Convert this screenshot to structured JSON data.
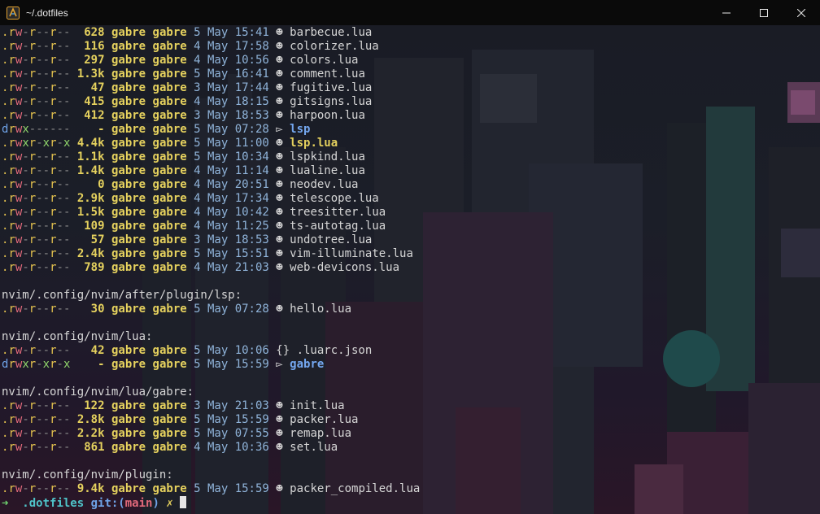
{
  "window": {
    "title": "~/.dotfiles",
    "minimize_icon": "minimize-icon",
    "maximize_icon": "maximize-icon",
    "close_icon": "close-icon"
  },
  "listing_1": [
    {
      "perms": ".rw-r--r--",
      "size": "628",
      "owner": "gabre gabre",
      "date": "5 May 15:41",
      "icon": "lua-file-icon",
      "glyph": "☻",
      "name": "barbecue.lua",
      "kind": "file"
    },
    {
      "perms": ".rw-r--r--",
      "size": "116",
      "owner": "gabre gabre",
      "date": "4 May 17:58",
      "icon": "lua-file-icon",
      "glyph": "☻",
      "name": "colorizer.lua",
      "kind": "file"
    },
    {
      "perms": ".rw-r--r--",
      "size": "297",
      "owner": "gabre gabre",
      "date": "4 May 10:56",
      "icon": "lua-file-icon",
      "glyph": "☻",
      "name": "colors.lua",
      "kind": "file"
    },
    {
      "perms": ".rw-r--r--",
      "size": "1.3k",
      "owner": "gabre gabre",
      "date": "5 May 16:41",
      "icon": "lua-file-icon",
      "glyph": "☻",
      "name": "comment.lua",
      "kind": "file"
    },
    {
      "perms": ".rw-r--r--",
      "size": "47",
      "owner": "gabre gabre",
      "date": "3 May 17:44",
      "icon": "lua-file-icon",
      "glyph": "☻",
      "name": "fugitive.lua",
      "kind": "file"
    },
    {
      "perms": ".rw-r--r--",
      "size": "415",
      "owner": "gabre gabre",
      "date": "4 May 18:15",
      "icon": "lua-file-icon",
      "glyph": "☻",
      "name": "gitsigns.lua",
      "kind": "file"
    },
    {
      "perms": ".rw-r--r--",
      "size": "412",
      "owner": "gabre gabre",
      "date": "3 May 18:53",
      "icon": "lua-file-icon",
      "glyph": "☻",
      "name": "harpoon.lua",
      "kind": "file"
    },
    {
      "perms": "drwx------",
      "size": "-",
      "owner": "gabre gabre",
      "date": "5 May 07:28",
      "icon": "folder-icon",
      "glyph": "▻",
      "name": "lsp",
      "kind": "dir"
    },
    {
      "perms": ".rwxr-xr-x",
      "size": "4.4k",
      "owner": "gabre gabre",
      "date": "5 May 11:00",
      "icon": "lua-file-icon",
      "glyph": "☻",
      "name": "lsp.lua",
      "kind": "exec"
    },
    {
      "perms": ".rw-r--r--",
      "size": "1.1k",
      "owner": "gabre gabre",
      "date": "5 May 10:34",
      "icon": "lua-file-icon",
      "glyph": "☻",
      "name": "lspkind.lua",
      "kind": "file"
    },
    {
      "perms": ".rw-r--r--",
      "size": "1.4k",
      "owner": "gabre gabre",
      "date": "4 May 11:14",
      "icon": "lua-file-icon",
      "glyph": "☻",
      "name": "lualine.lua",
      "kind": "file"
    },
    {
      "perms": ".rw-r--r--",
      "size": "0",
      "owner": "gabre gabre",
      "date": "4 May 20:51",
      "icon": "lua-file-icon",
      "glyph": "☻",
      "name": "neodev.lua",
      "kind": "file"
    },
    {
      "perms": ".rw-r--r--",
      "size": "2.9k",
      "owner": "gabre gabre",
      "date": "4 May 17:34",
      "icon": "lua-file-icon",
      "glyph": "☻",
      "name": "telescope.lua",
      "kind": "file"
    },
    {
      "perms": ".rw-r--r--",
      "size": "1.5k",
      "owner": "gabre gabre",
      "date": "4 May 10:42",
      "icon": "lua-file-icon",
      "glyph": "☻",
      "name": "treesitter.lua",
      "kind": "file"
    },
    {
      "perms": ".rw-r--r--",
      "size": "109",
      "owner": "gabre gabre",
      "date": "4 May 11:25",
      "icon": "lua-file-icon",
      "glyph": "☻",
      "name": "ts-autotag.lua",
      "kind": "file"
    },
    {
      "perms": ".rw-r--r--",
      "size": "57",
      "owner": "gabre gabre",
      "date": "3 May 18:53",
      "icon": "lua-file-icon",
      "glyph": "☻",
      "name": "undotree.lua",
      "kind": "file"
    },
    {
      "perms": ".rw-r--r--",
      "size": "2.4k",
      "owner": "gabre gabre",
      "date": "5 May 15:51",
      "icon": "lua-file-icon",
      "glyph": "☻",
      "name": "vim-illuminate.lua",
      "kind": "file"
    },
    {
      "perms": ".rw-r--r--",
      "size": "789",
      "owner": "gabre gabre",
      "date": "4 May 21:03",
      "icon": "lua-file-icon",
      "glyph": "☻",
      "name": "web-devicons.lua",
      "kind": "file"
    }
  ],
  "section_2": {
    "heading": "nvim/.config/nvim/after/plugin/lsp:",
    "rows": [
      {
        "perms": ".rw-r--r--",
        "size": "30",
        "owner": "gabre gabre",
        "date": "5 May 07:28",
        "icon": "lua-file-icon",
        "glyph": "☻",
        "name": "hello.lua",
        "kind": "file"
      }
    ]
  },
  "section_3": {
    "heading": "nvim/.config/nvim/lua:",
    "rows": [
      {
        "perms": ".rw-r--r--",
        "size": "42",
        "owner": "gabre gabre",
        "date": "5 May 10:06",
        "icon": "json-file-icon",
        "glyph": "{}",
        "name": ".luarc.json",
        "kind": "file"
      },
      {
        "perms": "drwxr-xr-x",
        "size": "-",
        "owner": "gabre gabre",
        "date": "5 May 15:59",
        "icon": "folder-icon",
        "glyph": "▻",
        "name": "gabre",
        "kind": "dir"
      }
    ]
  },
  "section_4": {
    "heading": "nvim/.config/nvim/lua/gabre:",
    "rows": [
      {
        "perms": ".rw-r--r--",
        "size": "122",
        "owner": "gabre gabre",
        "date": "3 May 21:03",
        "icon": "lua-file-icon",
        "glyph": "☻",
        "name": "init.lua",
        "kind": "file"
      },
      {
        "perms": ".rw-r--r--",
        "size": "2.8k",
        "owner": "gabre gabre",
        "date": "5 May 15:59",
        "icon": "lua-file-icon",
        "glyph": "☻",
        "name": "packer.lua",
        "kind": "file"
      },
      {
        "perms": ".rw-r--r--",
        "size": "2.2k",
        "owner": "gabre gabre",
        "date": "5 May 07:55",
        "icon": "lua-file-icon",
        "glyph": "☻",
        "name": "remap.lua",
        "kind": "file"
      },
      {
        "perms": ".rw-r--r--",
        "size": "861",
        "owner": "gabre gabre",
        "date": "4 May 10:36",
        "icon": "lua-file-icon",
        "glyph": "☻",
        "name": "set.lua",
        "kind": "file"
      }
    ]
  },
  "section_5": {
    "heading": "nvim/.config/nvim/plugin:",
    "rows": [
      {
        "perms": ".rw-r--r--",
        "size": "9.4k",
        "owner": "gabre gabre",
        "date": "5 May 15:59",
        "icon": "lua-file-icon",
        "glyph": "☻",
        "name": "packer_compiled.lua",
        "kind": "file"
      }
    ]
  },
  "prompt": {
    "arrow": "➜",
    "dir": ".dotfiles",
    "git_label": "git:(",
    "branch": "main",
    "git_close": ")",
    "dirty_mark": "✗"
  },
  "colors": {
    "terminal_bg": "#15131b",
    "titlebar_bg": "#0a0a0a",
    "size_yellow": "#e5d15e",
    "dir_blue": "#74a7ef",
    "prompt_green": "#6fd36f",
    "prompt_cyan": "#4fc3c9",
    "branch_red": "#e0697a"
  }
}
